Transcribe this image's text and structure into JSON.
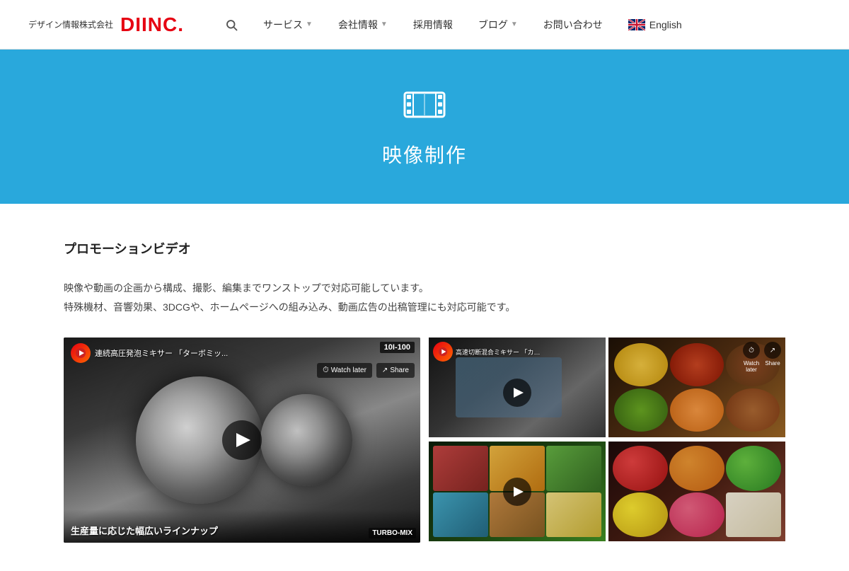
{
  "header": {
    "logo_jp": "デザイン情報株式会社",
    "logo_en": "DIINC.",
    "nav": {
      "search_label": "🔍",
      "items": [
        {
          "id": "services",
          "label": "サービス",
          "has_dropdown": true
        },
        {
          "id": "company",
          "label": "会社情報",
          "has_dropdown": true
        },
        {
          "id": "recruitment",
          "label": "採用情報",
          "has_dropdown": false
        },
        {
          "id": "blog",
          "label": "ブログ",
          "has_dropdown": true
        },
        {
          "id": "contact",
          "label": "お問い合わせ",
          "has_dropdown": false
        }
      ],
      "language": "English"
    }
  },
  "hero": {
    "icon": "🎞",
    "title": "映像制作"
  },
  "main": {
    "section_title": "プロモーションビデオ",
    "description_line1": "映像や動画の企画から構成、撮影、編集までワンストップで対応可能しています。",
    "description_line2": "特殊機材、音響効果、3DCGや、ホームページへの組み込み、動画広告の出稿管理にも対応可能です。"
  },
  "videos": {
    "left": {
      "channel_icon": "A",
      "title": "連続高圧発泡ミキサー 「ターボミッ...",
      "actions": [
        "Watch later",
        "Share"
      ],
      "counter": "10I-100",
      "bottom_text": "生産量に応じた幅広いラインナップ",
      "logo": "TURBO-MIX"
    },
    "right": [
      {
        "channel_icon": "A",
        "title": "高速切断混合ミキサー 「カッターミ...",
        "has_watch_later": false
      },
      {
        "watch_later": "Watch later",
        "share": "Share",
        "has_watch_later": true
      },
      {
        "spices": true
      },
      {
        "fruits": true
      }
    ]
  },
  "colors": {
    "accent": "#29a8dc",
    "logo_red": "#e60012",
    "hero_bg": "#29a8dc"
  }
}
